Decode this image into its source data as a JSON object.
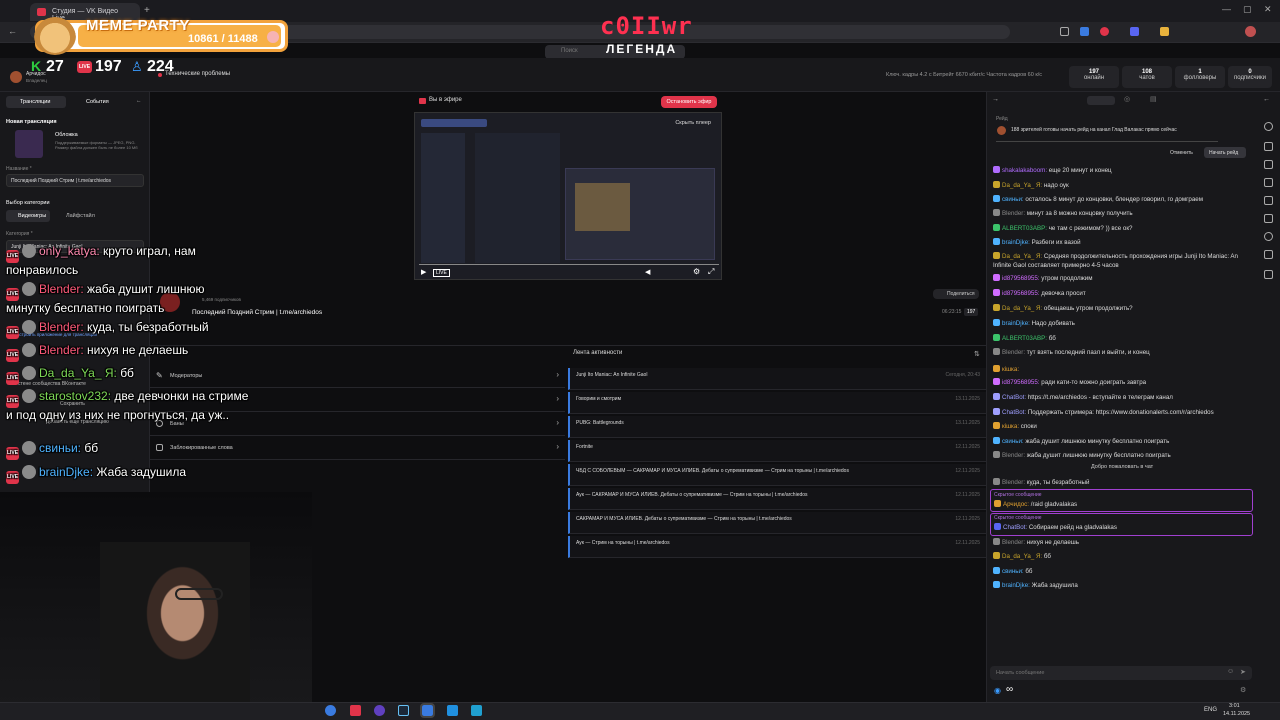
{
  "browser": {
    "tab_title": "Студия — VK Видео Live",
    "new_tab": "+",
    "win_controls": [
      "—",
      "▢",
      "✕"
    ]
  },
  "overlay": {
    "meme_title": "MEME PARTY",
    "meme_count": "10861 / 11488",
    "channel_name": "c0IIwr",
    "banner": "ЛЕГЕНДА",
    "search_placeholder": "Поиск"
  },
  "stats_bar": {
    "k_count": "27",
    "live_count": "197",
    "viewers_count": "224",
    "owner_name": "Арчидос",
    "owner_role": "Владелец",
    "problems": "Технические проблемы",
    "bitrate_text": "Ключ. кадры 4.2 с  Битрейт 6670 кбит/с  Частота кадров 60 к/с",
    "cards": [
      {
        "value": "197",
        "label": "онлайн"
      },
      {
        "value": "108",
        "label": "чатов"
      },
      {
        "value": "1",
        "label": "фолловеры"
      },
      {
        "value": "0",
        "label": "подписчики"
      }
    ]
  },
  "left_panel": {
    "tab_broadcasts": "Трансляции",
    "tab_events": "События",
    "new_stream": "Новая трансляция",
    "cover_label": "Обложка",
    "cover_hint": "Поддерживаемые форматы — JPEG, PNG. Размер файла должен быть не более 10 Мб",
    "name_label": "Название *",
    "name_value": "Последний Поздний Стрим | t.me/archiedos",
    "category_choice": "Выбор категории",
    "cat_games": "Видеоигры",
    "cat_lifestyle": "Лайфстайл",
    "category_label": "Категория *",
    "category_value": "Junji Ito Maniac: An Infinite Gaol",
    "group_text": "стене сообщества ВКонтакте",
    "save_label": "Сохранить",
    "add_stream": "Добавить ещё трансляцию",
    "mobile_link": "Как настроить приложение для трансляции"
  },
  "center": {
    "on_air": "Вы в эфире",
    "stop_button": "Остановить эфир",
    "hide_player": "Скрыть плеер",
    "stream_title": "Последний Поздний Стрим | t.me/archiedos",
    "subscribers": "5,469 подписчиков",
    "share": "Поделиться",
    "duration": "06:23:15",
    "viewer_badge": "197",
    "menu": [
      "Модераторы",
      "",
      "Баны",
      "Заблокированные слова"
    ],
    "activity_title": "Лента активности",
    "activity": [
      {
        "text": "Junji Ito Maniac: An Infinite Gaol",
        "time": "Сегодня, 20:43"
      },
      {
        "text": "Говорим и смотрим",
        "time": "13.11.2025"
      },
      {
        "text": "PUBG: Battlegrounds",
        "time": "13.11.2025"
      },
      {
        "text": "Fortnite",
        "time": "12.11.2025"
      },
      {
        "text": "ЧБД С СОБОЛЕВЫМ — САКРАМАР И МУСА ИЛИЕВ. Дебаты о супремативизме — Стрим на торыны | t.me/archiedos",
        "time": "12.11.2025"
      },
      {
        "text": "Аук — САКРАМАР И МУСА ИЛИЕВ. Дебаты о супремативизме — Стрим на торыны | t.me/archiedos",
        "time": "12.11.2025"
      },
      {
        "text": "САКРАМАР И МУСА ИЛИЕВ. Дебаты о супремативизме — Стрим на торыны | t.me/archiedos",
        "time": "12.11.2025"
      },
      {
        "text": "Аук — Стрим на торыны | t.me/archiedos",
        "time": "12.11.2025"
      }
    ]
  },
  "chat": {
    "raid_label": "Рейд",
    "raid_text": "188 зрителей готовы начать рейд на канал Глад Валакас прямо сейчас",
    "cancel": "Отменить",
    "start_raid": "Начать рейд",
    "messages": [
      {
        "user": "shakalakaboom:",
        "text": "еще 20 минут и конец",
        "color": "#b06cff"
      },
      {
        "user": "Da_da_Ya_ Я:",
        "text": "надо оук",
        "color": "#c9a52b"
      },
      {
        "user": "свиньи:",
        "text": "осталось 8 минут до концовки, блендер говорил, го домграем",
        "color": "#4fb3ff"
      },
      {
        "user": "Blender:",
        "text": "минут за 8 можно концовку получить",
        "color": "#888888"
      },
      {
        "user": "ALBERT03ABP:",
        "text": "че там с режимом? )) все ок?",
        "color": "#3cc46b"
      },
      {
        "user": "brainDjke:",
        "text": "Разбеги их вазой",
        "color": "#4fb3ff"
      },
      {
        "user": "Da_da_Ya_ Я:",
        "text": "Средняя продолжительность прохождения игры Junji Ito Maniac: An Infinite Gaol составляет примерно 4-5 часов",
        "color": "#c9a52b"
      },
      {
        "user": "id879568955:",
        "text": "утром продолжим",
        "color": "#d06cff"
      },
      {
        "user": "id879568955:",
        "text": "девочка просит",
        "color": "#d06cff"
      },
      {
        "user": "Da_da_Ya_ Я:",
        "text": "обещаешь утром продолжить?",
        "color": "#c9a52b"
      },
      {
        "user": "brainDjke:",
        "text": "Надо добивать",
        "color": "#4fb3ff"
      },
      {
        "user": "ALBERT03ABP:",
        "text": "бб",
        "color": "#3cc46b"
      },
      {
        "user": "Blender:",
        "text": "тут взять последний пазл и выйти, и конец",
        "color": "#888888"
      },
      {
        "user": "кішка:",
        "text": "",
        "color": "#e0a030"
      },
      {
        "user": "id879568955:",
        "text": "ради кати-то можно доиграть завтра",
        "color": "#d06cff"
      },
      {
        "user": "ChatBot:",
        "text": "https://t.me/archiedos - вступайте в телеграм канал",
        "color": "#9f9fff"
      },
      {
        "user": "ChatBot:",
        "text": "Поддержать стримера: https://www.donationalerts.com/r/archiedos",
        "color": "#9f9fff"
      },
      {
        "user": "кішка:",
        "text": "споки",
        "color": "#e0a030"
      },
      {
        "user": "свиньи:",
        "text": "жаба душит лишнюю минутку бесплатно поиграть",
        "color": "#4fb3ff"
      },
      {
        "user": "Blender:",
        "text": "жаба душит лишнюю минутку бесплатно поиграть",
        "color": "#888888"
      }
    ],
    "welcome": "Добро пожаловать в чат",
    "blender_last": {
      "user": "Blender:",
      "text": "куда, ты безработный",
      "color": "#888888"
    },
    "hidden1_label": "Скрытое сообщение",
    "hidden1": {
      "user": "Арчидос:",
      "text": "/raid gladvalakas",
      "color": "#e0a030"
    },
    "hidden2_label": "Скрытое сообщение",
    "hidden2": {
      "user": "ChatBot:",
      "text": "Собираем рейд на gladvalakas",
      "color": "#9f9fff"
    },
    "tail": [
      {
        "user": "Blender:",
        "text": "нихуя не делаешь",
        "color": "#888888"
      },
      {
        "user": "Da_da_Ya_ Я:",
        "text": "бб",
        "color": "#c9a52b"
      },
      {
        "user": "свиньи:",
        "text": "бб",
        "color": "#4fb3ff"
      },
      {
        "user": "brainDjke:",
        "text": "Жаба задушила",
        "color": "#4fb3ff"
      }
    ],
    "input_placeholder": "Начать сообщение",
    "points": "∞"
  },
  "overlay_chat": [
    {
      "user": "only_katya:",
      "text": "круто играл, нам понравилось",
      "color": "#ff8ab0"
    },
    {
      "user": "Blender:",
      "text": "жаба душит лишнюю минутку бесплатно поиграть",
      "color": "#ff5a7a"
    },
    {
      "user": "Blender:",
      "text": "куда, ты безработный",
      "color": "#ff5a7a"
    },
    {
      "user": "Blender:",
      "text": "нихуя не делаешь",
      "color": "#ff5a7a"
    },
    {
      "user": "Da_da_Ya_ Я:",
      "text": "бб",
      "color": "#7ed957"
    },
    {
      "user": "starostov232:",
      "text": "две девчонки на стриме и под одну из них не прогнуться, да уж..",
      "color": "#7ed957"
    },
    {
      "user": "свиньи:",
      "text": "бб",
      "color": "#4fb3ff"
    },
    {
      "user": "brainDjke:",
      "text": "Жаба задушила",
      "color": "#4fb3ff"
    }
  ],
  "taskbar": {
    "lang": "ENG",
    "time": "3:01",
    "date": "14.11.2025"
  }
}
